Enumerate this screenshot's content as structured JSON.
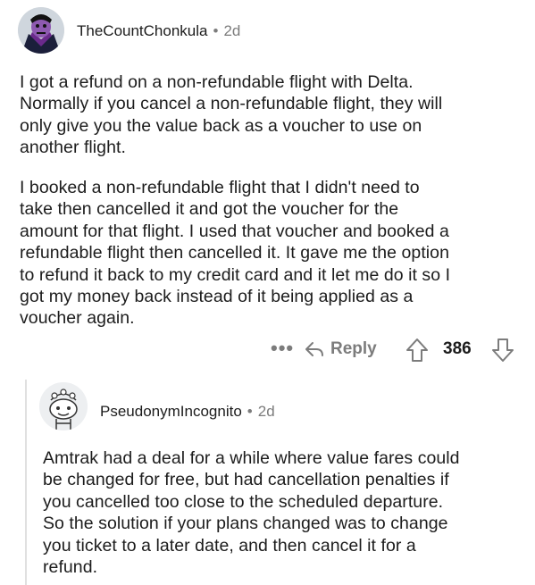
{
  "comment": {
    "username": "TheCountChonkula",
    "separator": "•",
    "time": "2d",
    "lines_p1": [
      "I got a refund on a non-refundable flight with Delta.",
      "Normally if you cancel a non-refundable flight, they will",
      "only give you the value back as a voucher to use on",
      "another flight."
    ],
    "lines_p2": [
      "I booked a non-refundable flight that I didn't need to",
      "take then cancelled it and got the voucher for the",
      "amount for that flight. I used that voucher and booked a",
      "refundable flight then cancelled it. It gave me the option",
      "to refund it back to my credit card and it let me do it so I",
      "got my money back instead of it being applied as a",
      "voucher again."
    ],
    "more": "•••",
    "reply_label": "Reply",
    "score": "386"
  },
  "reply": {
    "username": "PseudonymIncognito",
    "separator": "•",
    "time": "2d",
    "lines": [
      "Amtrak had a deal for a while where value fares could",
      "be changed for free, but had cancellation penalties if",
      "you cancelled too close to the scheduled departure.",
      "So the solution if your plans changed was to change",
      "you ticket to a later date, and then cancel it for a",
      "refund."
    ]
  },
  "icons": {
    "avatar1": "vampire-count-avatar-icon",
    "avatar2": "snoo-avatar-icon",
    "more": "more-options-icon",
    "reply": "reply-arrow-icon",
    "upvote": "upvote-arrow-icon",
    "downvote": "downvote-arrow-icon"
  }
}
